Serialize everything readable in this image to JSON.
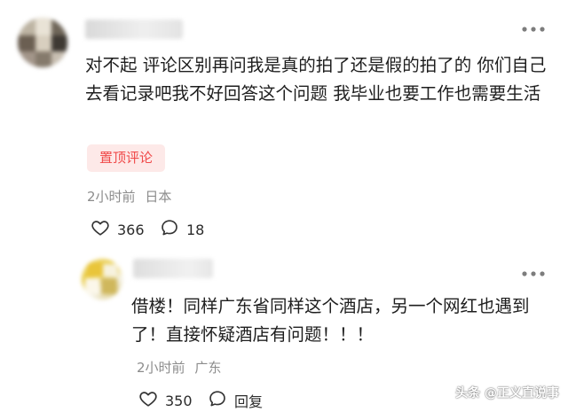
{
  "comments": [
    {
      "more_icon": "more-horizontal-icon",
      "text": "对不起 评论区别再问我是真的拍了还是假的拍了的 你们自己去看记录吧我不好回答这个问题 我毕业也要工作也需要生活",
      "badge": "置顶评论",
      "time": "2小时前",
      "location": "日本",
      "likes": "366",
      "replies": "18",
      "colors": {
        "badge_bg": "#fde9e8",
        "badge_text": "#f04a4a"
      }
    },
    {
      "more_icon": "more-horizontal-icon",
      "text": "借楼！同样广东省同样这个酒店，另一个网红也遇到了！直接怀疑酒店有问题！！！",
      "time": "2小时前",
      "location": "广东",
      "likes": "350",
      "reply_label": "回复"
    }
  ],
  "watermark": "头条 @正义直说事",
  "icons": {
    "like": "heart-outline-icon",
    "comment": "comment-bubble-icon",
    "reply": "reply-bubble-icon"
  }
}
